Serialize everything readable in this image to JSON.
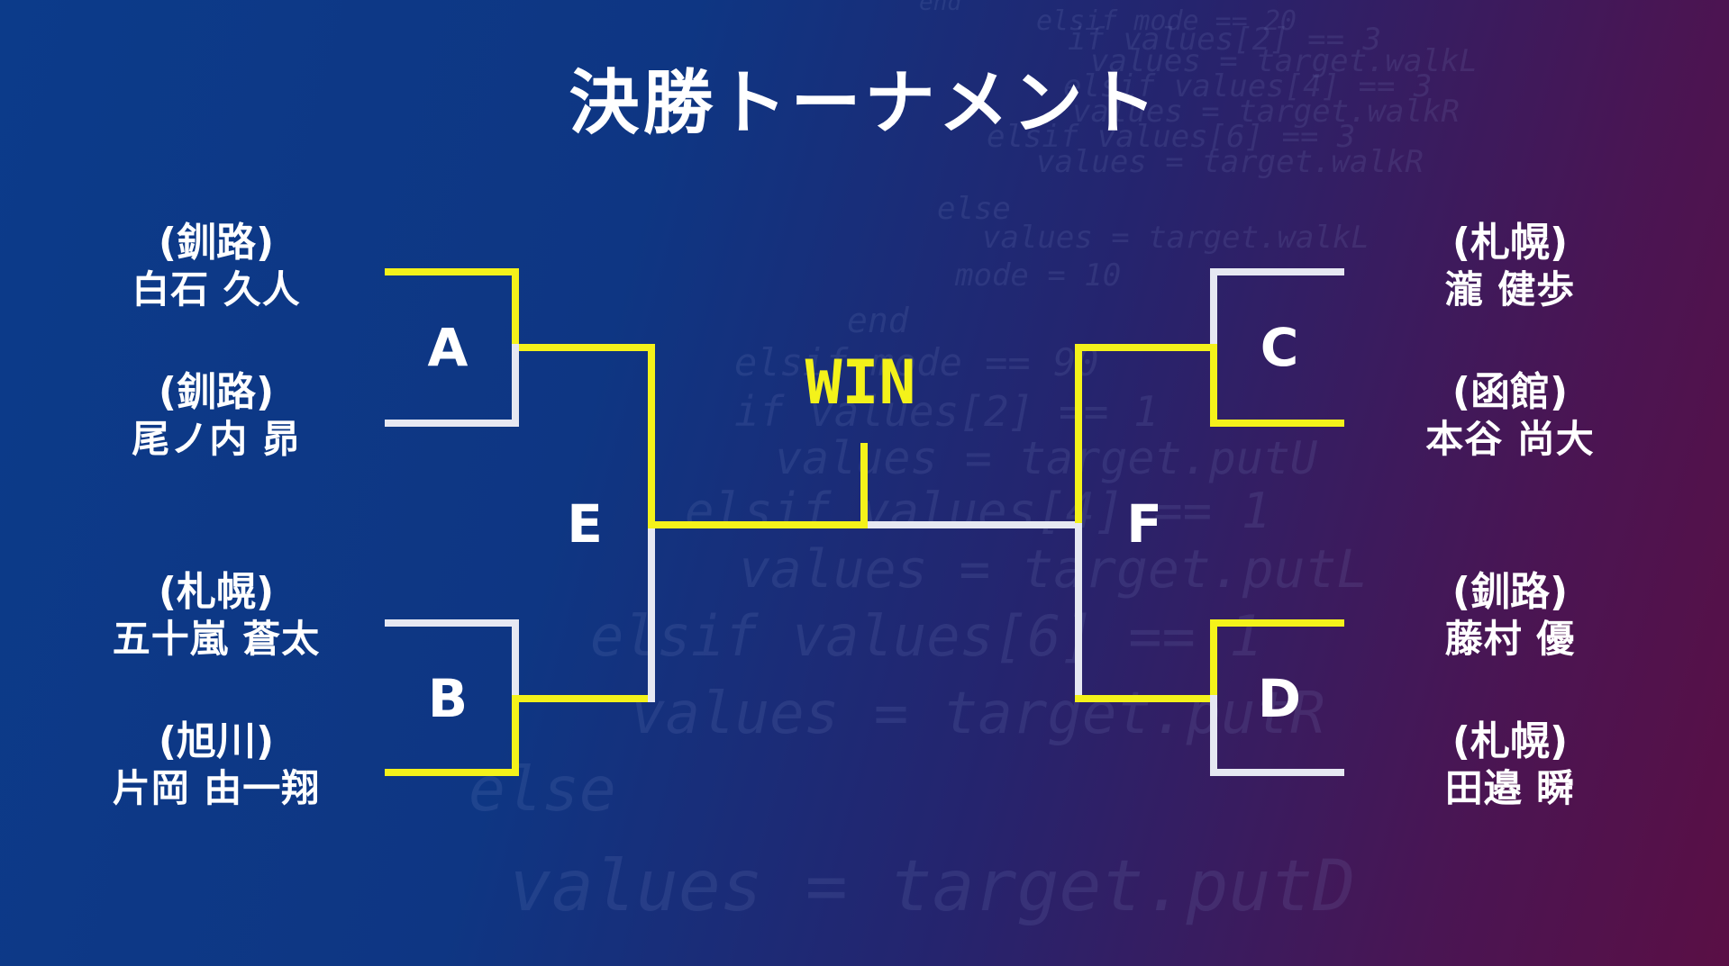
{
  "title": "決勝トーナメント",
  "win_label": "WIN",
  "colors": {
    "winner_line": "#f4f21a",
    "loser_line": "#e6e8f2",
    "text": "#ffffff"
  },
  "players": [
    {
      "slot": "A1",
      "city": "(釧路)",
      "name": "白石 久人"
    },
    {
      "slot": "A2",
      "city": "(釧路)",
      "name": "尾ノ内 昴"
    },
    {
      "slot": "B1",
      "city": "(札幌)",
      "name": "五十嵐 蒼太"
    },
    {
      "slot": "B2",
      "city": "(旭川)",
      "name": "片岡 由一翔"
    },
    {
      "slot": "C1",
      "city": "(札幌)",
      "name": "瀧 健歩"
    },
    {
      "slot": "C2",
      "city": "(函館)",
      "name": "本谷 尚大"
    },
    {
      "slot": "D1",
      "city": "(釧路)",
      "name": "藤村 優"
    },
    {
      "slot": "D2",
      "city": "(札幌)",
      "name": "田邉 瞬"
    }
  ],
  "matches": [
    {
      "id": "A",
      "winner": "A1"
    },
    {
      "id": "B",
      "winner": "B2"
    },
    {
      "id": "C",
      "winner": "C2"
    },
    {
      "id": "D",
      "winner": "D1"
    },
    {
      "id": "E",
      "winner": "A"
    },
    {
      "id": "F",
      "winner": "D"
    },
    {
      "id": "final",
      "winner": "E"
    }
  ],
  "background_code": [
    "end",
    "elsif mode == 20",
    "if values[2] == 3",
    "values = target.walkL",
    "elsif values[4] == 3",
    "values = target.walkR",
    "elsif values[6] == 3",
    "values = target.walkR",
    "else",
    "values = target.walkL",
    "mode = 10",
    "end",
    "elsif mode == 90",
    "if values[2] == 1",
    "values = target.putU",
    "elsif values[4] == 1",
    "values = target.putL",
    "elsif values[6] == 1",
    "values = target.putR",
    "else",
    "values = target.putD"
  ]
}
